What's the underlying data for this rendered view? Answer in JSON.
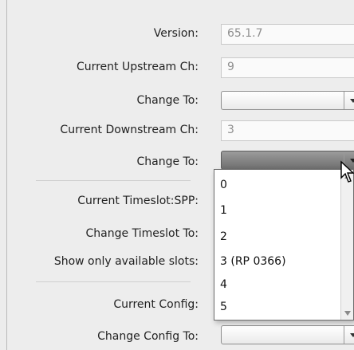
{
  "form": {
    "version": {
      "label": "Version:",
      "value": "65.1.7"
    },
    "current_upstream": {
      "label": "Current Upstream Ch:",
      "value": "9"
    },
    "change_to_upstream": {
      "label": "Change To:"
    },
    "current_downstream": {
      "label": "Current Downstream Ch:",
      "value": "3"
    },
    "change_to_downstream": {
      "label": "Change To:"
    },
    "current_timeslot": {
      "label": "Current Timeslot:SPP:"
    },
    "change_timeslot": {
      "label": "Change Timeslot To:"
    },
    "show_available": {
      "label": "Show only available slots:"
    },
    "current_config": {
      "label": "Current Config:"
    },
    "change_config": {
      "label": "Change Config To:"
    }
  },
  "dropdown": {
    "options": [
      "0",
      "1",
      "2",
      "3 (RP 0366)",
      "4",
      "5"
    ]
  },
  "icons": {
    "combo_arrow": "chevron-down-icon",
    "cursor": "mouse-pointer-icon"
  }
}
